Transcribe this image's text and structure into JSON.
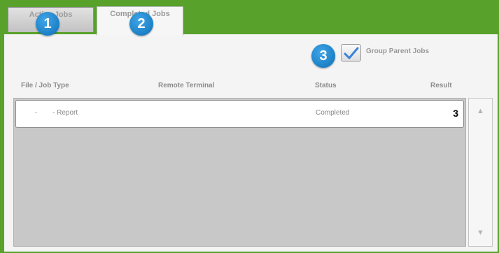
{
  "tabs": {
    "active_jobs": "Active Jobs",
    "completed_jobs": "Completed Jobs"
  },
  "callouts": [
    "1",
    "2",
    "3"
  ],
  "group_parent_jobs": {
    "label": "Group Parent Jobs",
    "checked": true
  },
  "columns": [
    "File / Job Type",
    "Remote Terminal",
    "Status",
    "Result"
  ],
  "rows": [
    {
      "file_job_type_prefix": "-",
      "file_job_type": "- Report",
      "remote_terminal": "",
      "status": "Completed",
      "result": "3"
    }
  ],
  "scrollbar": {
    "up_icon": "▲",
    "down_icon": "▼"
  },
  "colors": {
    "frame_green": "#58a22c",
    "callout_blue": "#1a82cc",
    "checkmark_blue": "#3b82d6"
  }
}
